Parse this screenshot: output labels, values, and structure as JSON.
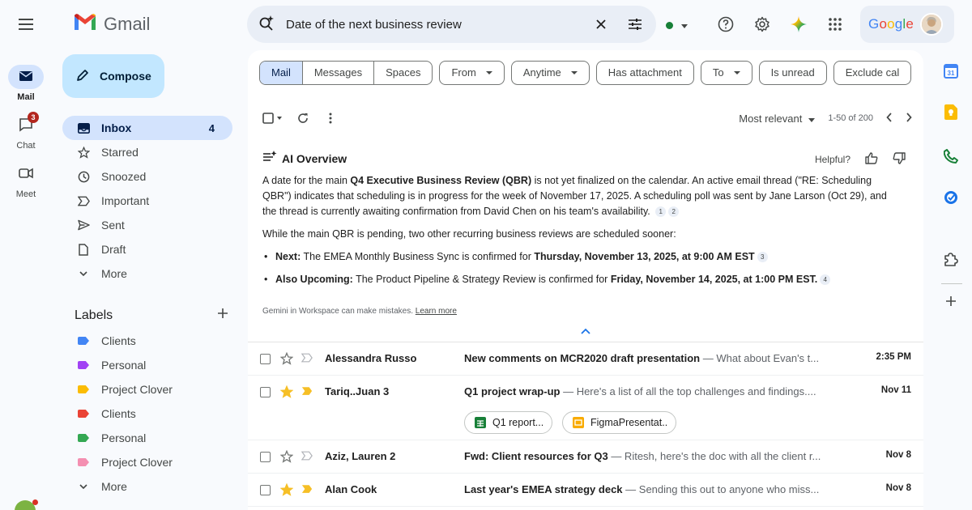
{
  "app": {
    "name": "Gmail",
    "account_logo": "Google"
  },
  "rail": [
    {
      "label": "Mail",
      "icon": "mail-icon",
      "active": true
    },
    {
      "label": "Chat",
      "icon": "chat-icon",
      "badge": "3"
    },
    {
      "label": "Meet",
      "icon": "video-icon"
    }
  ],
  "compose_label": "Compose",
  "nav": [
    {
      "label": "Inbox",
      "icon": "inbox-icon",
      "count": "4",
      "active": true
    },
    {
      "label": "Starred",
      "icon": "star-icon"
    },
    {
      "label": "Snoozed",
      "icon": "clock-icon"
    },
    {
      "label": "Important",
      "icon": "important-icon"
    },
    {
      "label": "Sent",
      "icon": "send-icon"
    },
    {
      "label": "Draft",
      "icon": "draft-icon"
    },
    {
      "label": "More",
      "icon": "chevron-down-icon"
    }
  ],
  "labels_title": "Labels",
  "labels": [
    {
      "label": "Clients",
      "color": "#4285f4"
    },
    {
      "label": "Personal",
      "color": "#a142f4"
    },
    {
      "label": "Project Clover",
      "color": "#fbbc04"
    },
    {
      "label": "Clients",
      "color": "#ea4335"
    },
    {
      "label": "Personal",
      "color": "#34a853"
    },
    {
      "label": "Project Clover",
      "color": "#f48fb1"
    }
  ],
  "labels_more": "More",
  "search": {
    "query": "Date of the next business review"
  },
  "filters": {
    "segments": [
      "Mail",
      "Messages",
      "Spaces"
    ],
    "chips": [
      "From",
      "Anytime",
      "Has attachment",
      "To",
      "Is unread",
      "Exclude cal"
    ]
  },
  "toolbar": {
    "sort": "Most relevant",
    "range": "1-50 of 200"
  },
  "ai_overview": {
    "title": "AI Overview",
    "helpful": "Helpful?",
    "p1_a": "A date for the main ",
    "p1_b": "Q4 Executive Business Review (QBR)",
    "p1_c": " is not yet finalized on the calendar. An active email thread (\"RE: Scheduling QBR\") indicates that scheduling is in progress for the week of November 17, 2025. A scheduling poll was sent by Jane Larson (Oct 29), and the thread is currently awaiting confirmation from David Chen on his team's availability.",
    "p1_cites": [
      "1",
      "2"
    ],
    "p2": "While the main QBR is pending, two other recurring business reviews are scheduled sooner:",
    "b1_label": "Next:",
    "b1_text": " The EMEA Monthly Business Sync is confirmed for ",
    "b1_date": "Thursday, November 13, 2025, at 9:00 AM EST",
    "b1_cite": "3",
    "b2_label": "Also Upcoming:",
    "b2_text": " The Product Pipeline & Strategy Review is confirmed for ",
    "b2_date": "Friday, November 14, 2025, at 1:00 PM EST.",
    "b2_cite": "4",
    "disclaimer": "Gemini in Workspace can make mistakes.",
    "learn_more": "Learn more"
  },
  "emails": [
    {
      "sender": "Alessandra Russo",
      "subject": "New comments on MCR2020 draft presentation",
      "snippet": " — What about Evan's t...",
      "date": "2:35 PM",
      "starred": false,
      "important": false
    },
    {
      "sender": "Tariq..Juan 3",
      "subject": "Q1 project wrap-up",
      "snippet": " — Here's a list of all the top challenges and findings....",
      "date": "Nov 11",
      "starred": true,
      "important": true,
      "attachments": [
        {
          "name": "Q1 report...",
          "color": "#188038"
        },
        {
          "name": "FigmaPresentat..",
          "color": "#f9ab00"
        }
      ]
    },
    {
      "sender": "Aziz, Lauren 2",
      "subject": "Fwd: Client resources for Q3",
      "snippet": " — Ritesh, here's the doc with all the client r...",
      "date": "Nov 8",
      "starred": false,
      "important": false
    },
    {
      "sender": "Alan Cook",
      "subject": "Last year's EMEA strategy deck",
      "snippet": " — Sending this out to anyone who miss...",
      "date": "Nov 8",
      "starred": true,
      "important": true
    }
  ]
}
